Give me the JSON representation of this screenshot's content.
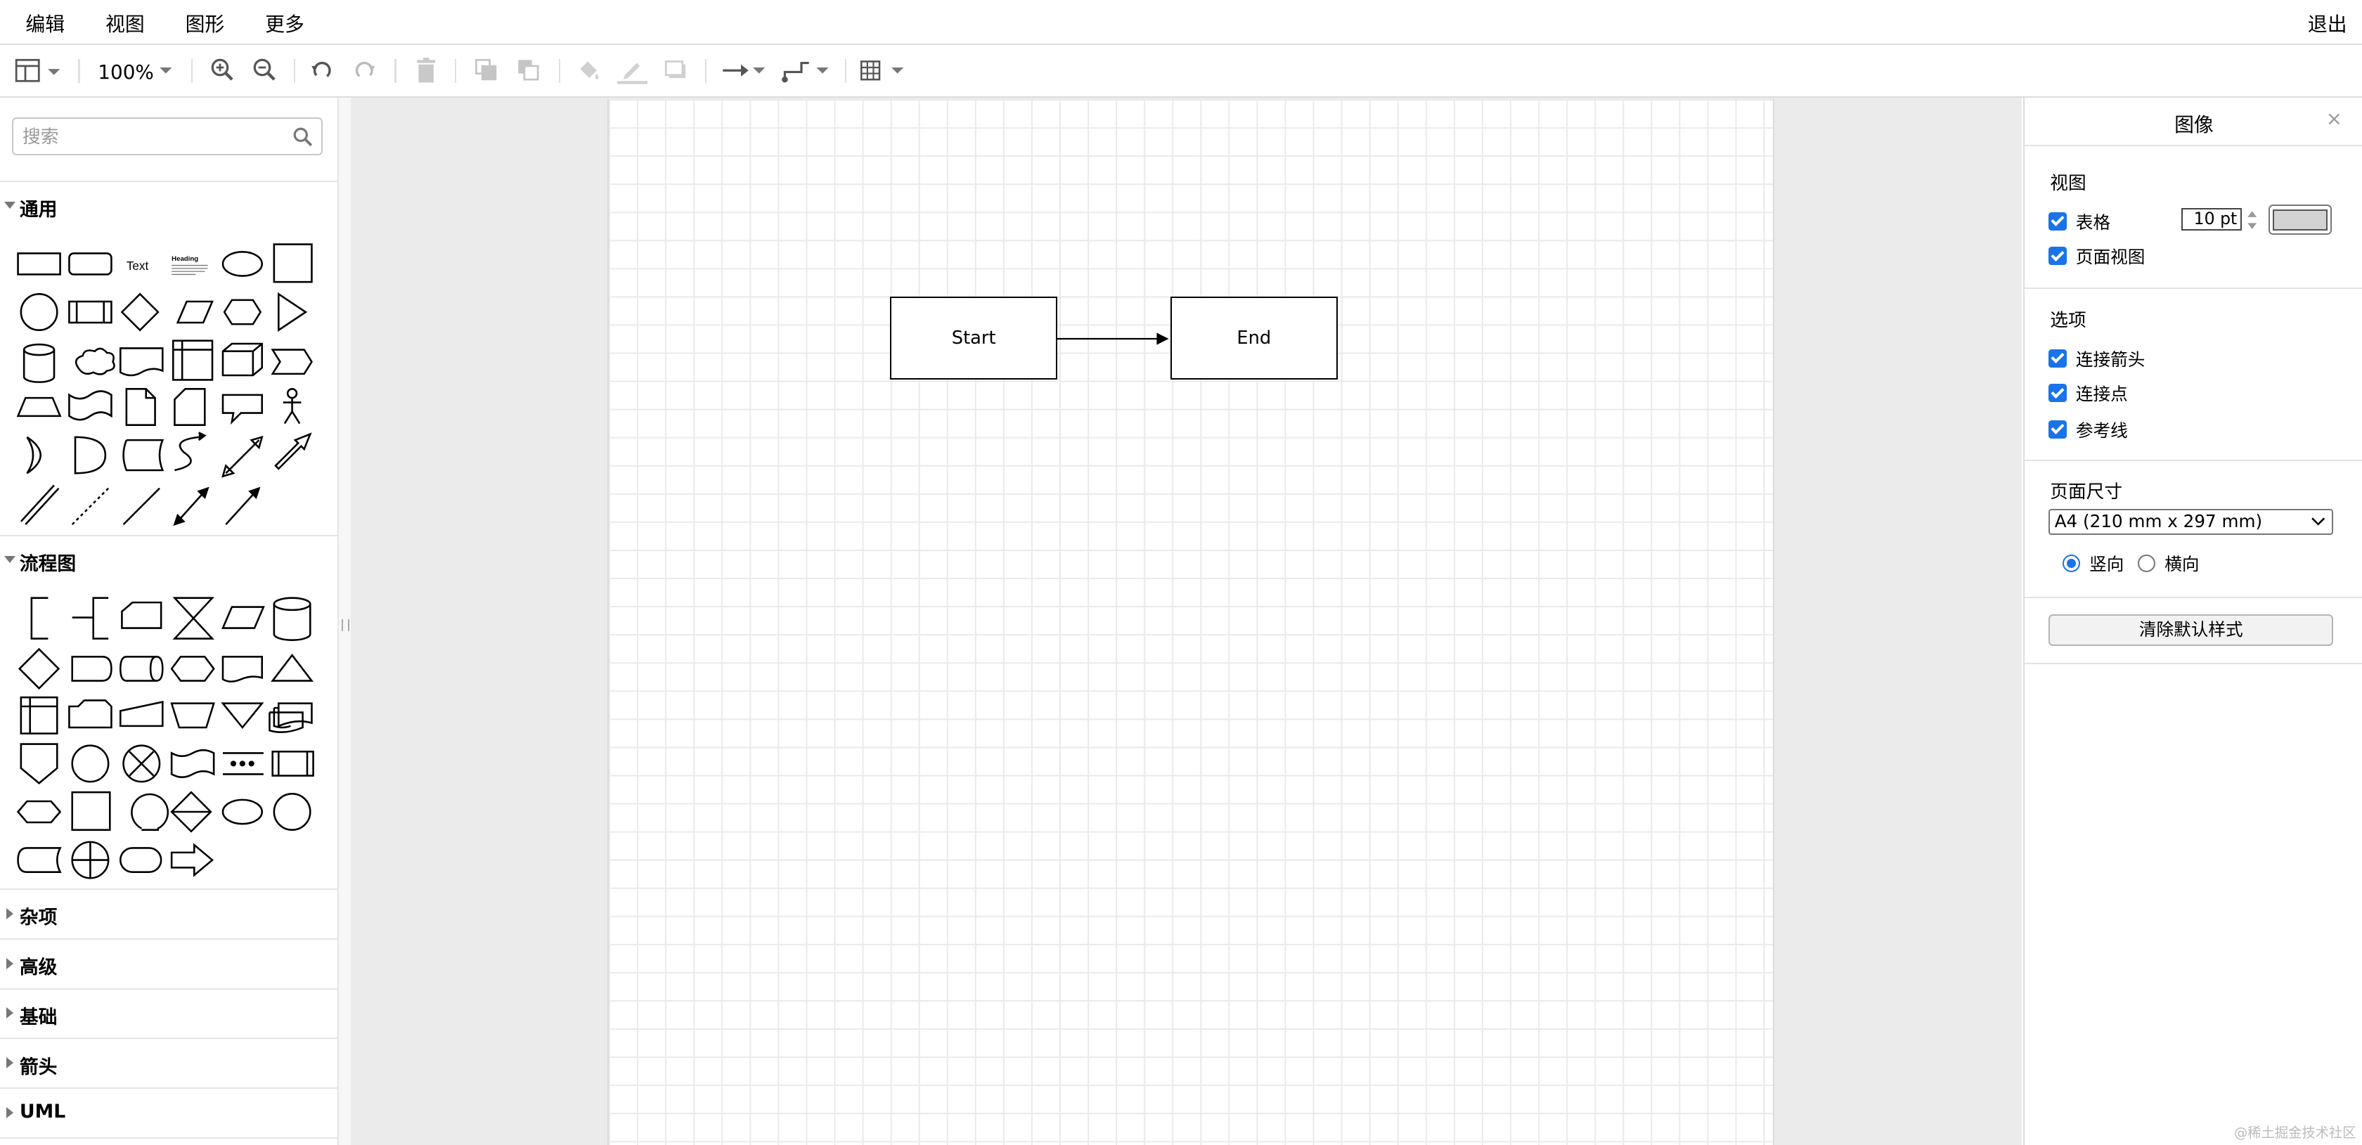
{
  "menubar": {
    "items": [
      "编辑",
      "视图",
      "图形",
      "更多"
    ],
    "exit_label": "退出"
  },
  "toolbar": {
    "zoom_label": "100%"
  },
  "sidebar": {
    "search_placeholder": "搜索",
    "sections": {
      "general": "通用",
      "flowchart": "流程图",
      "misc": "杂项",
      "advanced": "高级",
      "basic": "基础",
      "arrows": "箭头",
      "uml": "UML"
    },
    "general_shape_text": "Text",
    "general_shape_heading": "Heading"
  },
  "diagram": {
    "nodes": [
      "Start",
      "End"
    ]
  },
  "panel": {
    "title": "图像",
    "close": "×",
    "view_heading": "视图",
    "grid_label": "表格",
    "grid_size": "10 pt",
    "grid_color": "#d3d3d3",
    "page_view_label": "页面视图",
    "options_heading": "选项",
    "connection_arrows_label": "连接箭头",
    "connection_points_label": "连接点",
    "guides_label": "参考线",
    "page_size_heading": "页面尺寸",
    "page_size_value": "A4 (210 mm x 297 mm)",
    "portrait_label": "竖向",
    "landscape_label": "横向",
    "reset_style_button": "清除默认样式"
  },
  "watermark": "@稀土掘金技术社区",
  "colors": {
    "accent": "#1a73e8",
    "grid": "#eaeaea",
    "canvas_bg": "#ebebeb"
  }
}
